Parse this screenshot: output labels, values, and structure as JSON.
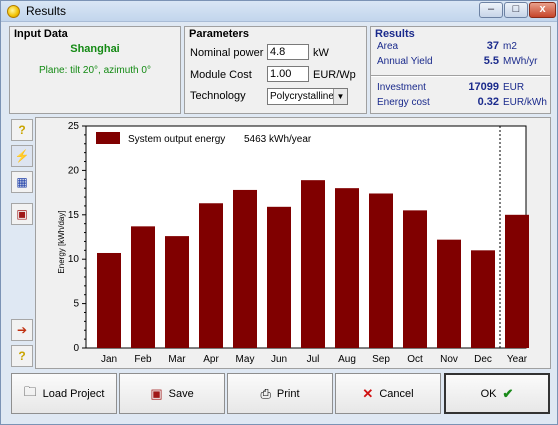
{
  "window": {
    "title": "Results"
  },
  "titlebar_buttons": {
    "minimize": "–",
    "maximize": "□",
    "close": "x"
  },
  "input_data": {
    "title": "Input Data",
    "city": "Shanghai",
    "plane": "Plane: tilt 20°, azimuth 0°"
  },
  "parameters": {
    "title": "Parameters",
    "nominal_power_label": "Nominal power",
    "nominal_power_value": "4.8",
    "nominal_power_unit": "kW",
    "module_cost_label": "Module Cost",
    "module_cost_value": "1.00",
    "module_cost_unit": "EUR/Wp",
    "technology_label": "Technology",
    "technology_value": "Polycrystalline"
  },
  "results": {
    "title": "Results",
    "area_label": "Area",
    "area_value": "37",
    "area_unit": "m2",
    "yield_label": "Annual Yield",
    "yield_value": "5.5",
    "yield_unit": "MWh/yr",
    "investment_label": "Investment",
    "investment_value": "17099",
    "investment_unit": "EUR",
    "energy_cost_label": "Energy cost",
    "energy_cost_value": "0.32",
    "energy_cost_unit": "EUR/kWh"
  },
  "sidebar": {
    "items": [
      {
        "name": "help-icon",
        "glyph": "?"
      },
      {
        "name": "energy-chart-icon",
        "glyph": "⚡"
      },
      {
        "name": "table-icon",
        "glyph": "▦"
      },
      {
        "name": "report-icon",
        "glyph": "▣"
      },
      {
        "name": "export-icon",
        "glyph": "➔"
      },
      {
        "name": "help-bottom-icon",
        "glyph": "?"
      }
    ]
  },
  "chart_data": {
    "type": "bar",
    "categories": [
      "Jan",
      "Feb",
      "Mar",
      "Apr",
      "May",
      "Jun",
      "Jul",
      "Aug",
      "Sep",
      "Oct",
      "Nov",
      "Dec",
      "Year"
    ],
    "series": [
      {
        "name": "System output energy",
        "values": [
          10.7,
          13.7,
          12.6,
          16.3,
          17.8,
          15.9,
          18.9,
          18.0,
          17.4,
          15.5,
          12.2,
          11.0,
          15.0
        ]
      }
    ],
    "legend_text": "System output energy",
    "legend_value": "5463 kWh/year",
    "ylabel": "Energy  [kWh/day]",
    "ylim": [
      0,
      25
    ],
    "yticks": [
      "0",
      "5",
      "10",
      "15",
      "20",
      "25"
    ],
    "legend": "top-left",
    "colors": {
      "bar": "#800000",
      "plot_bg": "#ffffff"
    },
    "grid": false
  },
  "buttons": {
    "load": "Load Project",
    "save": "Save",
    "print": "Print",
    "cancel": "Cancel",
    "ok": "OK"
  }
}
